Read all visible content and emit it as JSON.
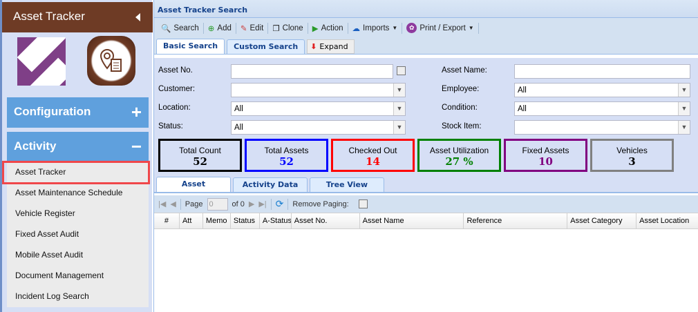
{
  "sidebar": {
    "title": "Asset Tracker",
    "sections": [
      {
        "label": "Configuration",
        "sign": "+"
      },
      {
        "label": "Activity",
        "sign": "−"
      }
    ],
    "items": [
      "Asset Tracker",
      "Asset Maintenance Schedule",
      "Vehicle Register",
      "Fixed Asset Audit",
      "Mobile Asset Audit",
      "Document Management",
      "Incident Log Search"
    ]
  },
  "main": {
    "title": "Asset Tracker Search",
    "toolbar": [
      "Search",
      "Add",
      "Edit",
      "Clone",
      "Action",
      "Imports",
      "Print / Export"
    ],
    "search_tabs": [
      "Basic Search",
      "Custom Search"
    ],
    "expand": "Expand",
    "form": {
      "asset_no": {
        "label": "Asset No.",
        "value": ""
      },
      "customer": {
        "label": "Customer:",
        "value": ""
      },
      "location": {
        "label": "Location:",
        "value": "All"
      },
      "status": {
        "label": "Status:",
        "value": "All"
      },
      "asset_name": {
        "label": "Asset Name:",
        "value": ""
      },
      "employee": {
        "label": "Employee:",
        "value": "All"
      },
      "condition": {
        "label": "Condition:",
        "value": "All"
      },
      "stock_item": {
        "label": "Stock Item:",
        "value": ""
      }
    },
    "stats": [
      {
        "label": "Total Count",
        "value": "52",
        "color": "#000000"
      },
      {
        "label": "Total Assets",
        "value": "52",
        "color": "#0000ff"
      },
      {
        "label": "Checked Out",
        "value": "14",
        "color": "#ff0000"
      },
      {
        "label": "Asset Utilization",
        "value": "27 %",
        "color": "#008000"
      },
      {
        "label": "Fixed Assets",
        "value": "10",
        "color": "#800080"
      },
      {
        "label": "Vehicles",
        "value": "3",
        "color": "#808080"
      }
    ],
    "result_tabs": [
      "Asset",
      "Activity Data",
      "Tree View"
    ],
    "paging": {
      "page_label": "Page",
      "page": "0",
      "of": "of 0",
      "remove_paging": "Remove Paging:"
    },
    "columns": [
      "#",
      "Att",
      "Memo",
      "Status",
      "A-Status",
      "Asset No.",
      "Asset Name",
      "Reference",
      "Asset Category",
      "Asset Location"
    ]
  }
}
